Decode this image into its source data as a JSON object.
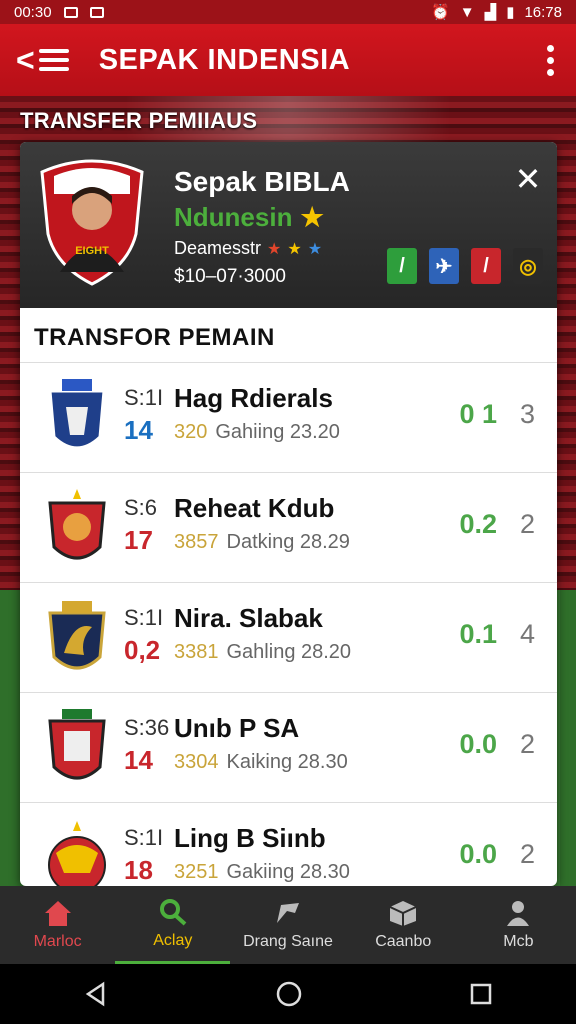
{
  "status_bar": {
    "time": "00:30",
    "clock": "16:78"
  },
  "app_bar": {
    "title": "SEPAK INDENSIA"
  },
  "section": {
    "heading": "TRANSFER PEMIIAUS"
  },
  "profile": {
    "name": "Sepak BIBLA",
    "country": "Ndunesin",
    "role": "Deamesstr",
    "value": "$10–07·3000",
    "crest_text": "EIGHT",
    "badges": [
      "/",
      "✈",
      "/",
      "◎"
    ]
  },
  "list": {
    "title": "TRANSFOR  PEMAIN",
    "rows": [
      {
        "pos": "S:1I",
        "num": "14",
        "num_color": "#1a6fc0",
        "name": "Hag Rdierals",
        "gold": "320",
        "club": "Gahiing 23.20",
        "score": "0 1",
        "rank": "3",
        "crest": "blue"
      },
      {
        "pos": "S:6",
        "num": "17",
        "num_color": "#c8262c",
        "name": "Reheat  Kdub",
        "gold": "3857",
        "club": "Datking 28.29",
        "score": "0.2",
        "rank": "2",
        "crest": "red"
      },
      {
        "pos": "S:1I",
        "num": "0,2",
        "num_color": "#c8262c",
        "name": "Nira. Slabak",
        "gold": "3381",
        "club": "Gahling 28.20",
        "score": "0.1",
        "rank": "4",
        "crest": "navy"
      },
      {
        "pos": "S:36",
        "num": "14",
        "num_color": "#c8262c",
        "name": "Unıb  P SA",
        "gold": "3304",
        "club": "Kaiking 28.30",
        "score": "0.0",
        "rank": "2",
        "crest": "red2"
      },
      {
        "pos": "S:1I",
        "num": "18",
        "num_color": "#c8262c",
        "name": "Ling B Siınb",
        "gold": "3251",
        "club": "Gakiing 28.30",
        "score": "0.0",
        "rank": "2",
        "crest": "eagle"
      }
    ]
  },
  "bottom_nav": [
    "Marloc",
    "Aclay",
    "Drang Saıne",
    "Caanbo",
    "Mcb"
  ],
  "icons": [
    "back-icon",
    "menu-icon",
    "more-icon",
    "close-icon",
    "star-icon",
    "home-icon",
    "search-icon",
    "ball-icon",
    "box-icon",
    "person-icon"
  ]
}
